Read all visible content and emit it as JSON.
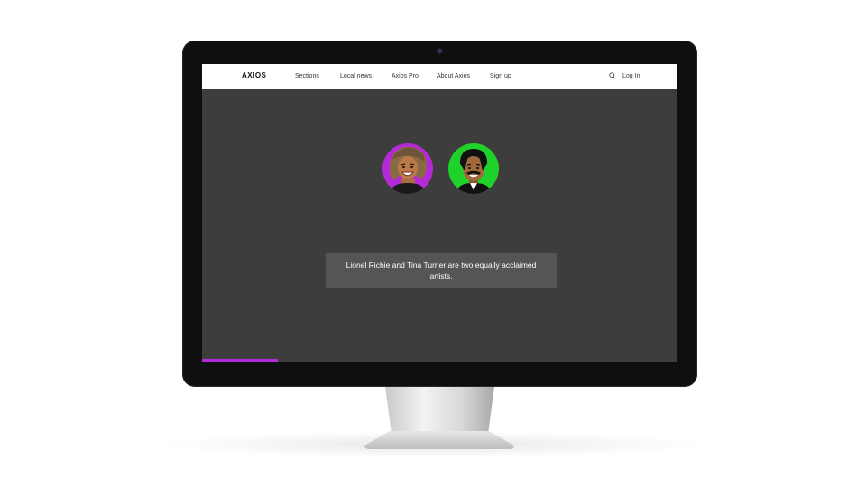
{
  "nav": {
    "logo": "AXIOS",
    "items": [
      "Sections",
      "Local news",
      "Axios Pro",
      "About Axios",
      "Sign up"
    ],
    "login": "Log In",
    "search_icon": "search-icon"
  },
  "content": {
    "caption": "Lionel Richie and Tina Turner are two equally acclaimed artists.",
    "progress": 0.16
  },
  "colors": {
    "screen_bg": "#3d3d3d",
    "accent_purple": "#b42ad6",
    "accent_green": "#1fd22a",
    "caption_bg": "#555555"
  }
}
